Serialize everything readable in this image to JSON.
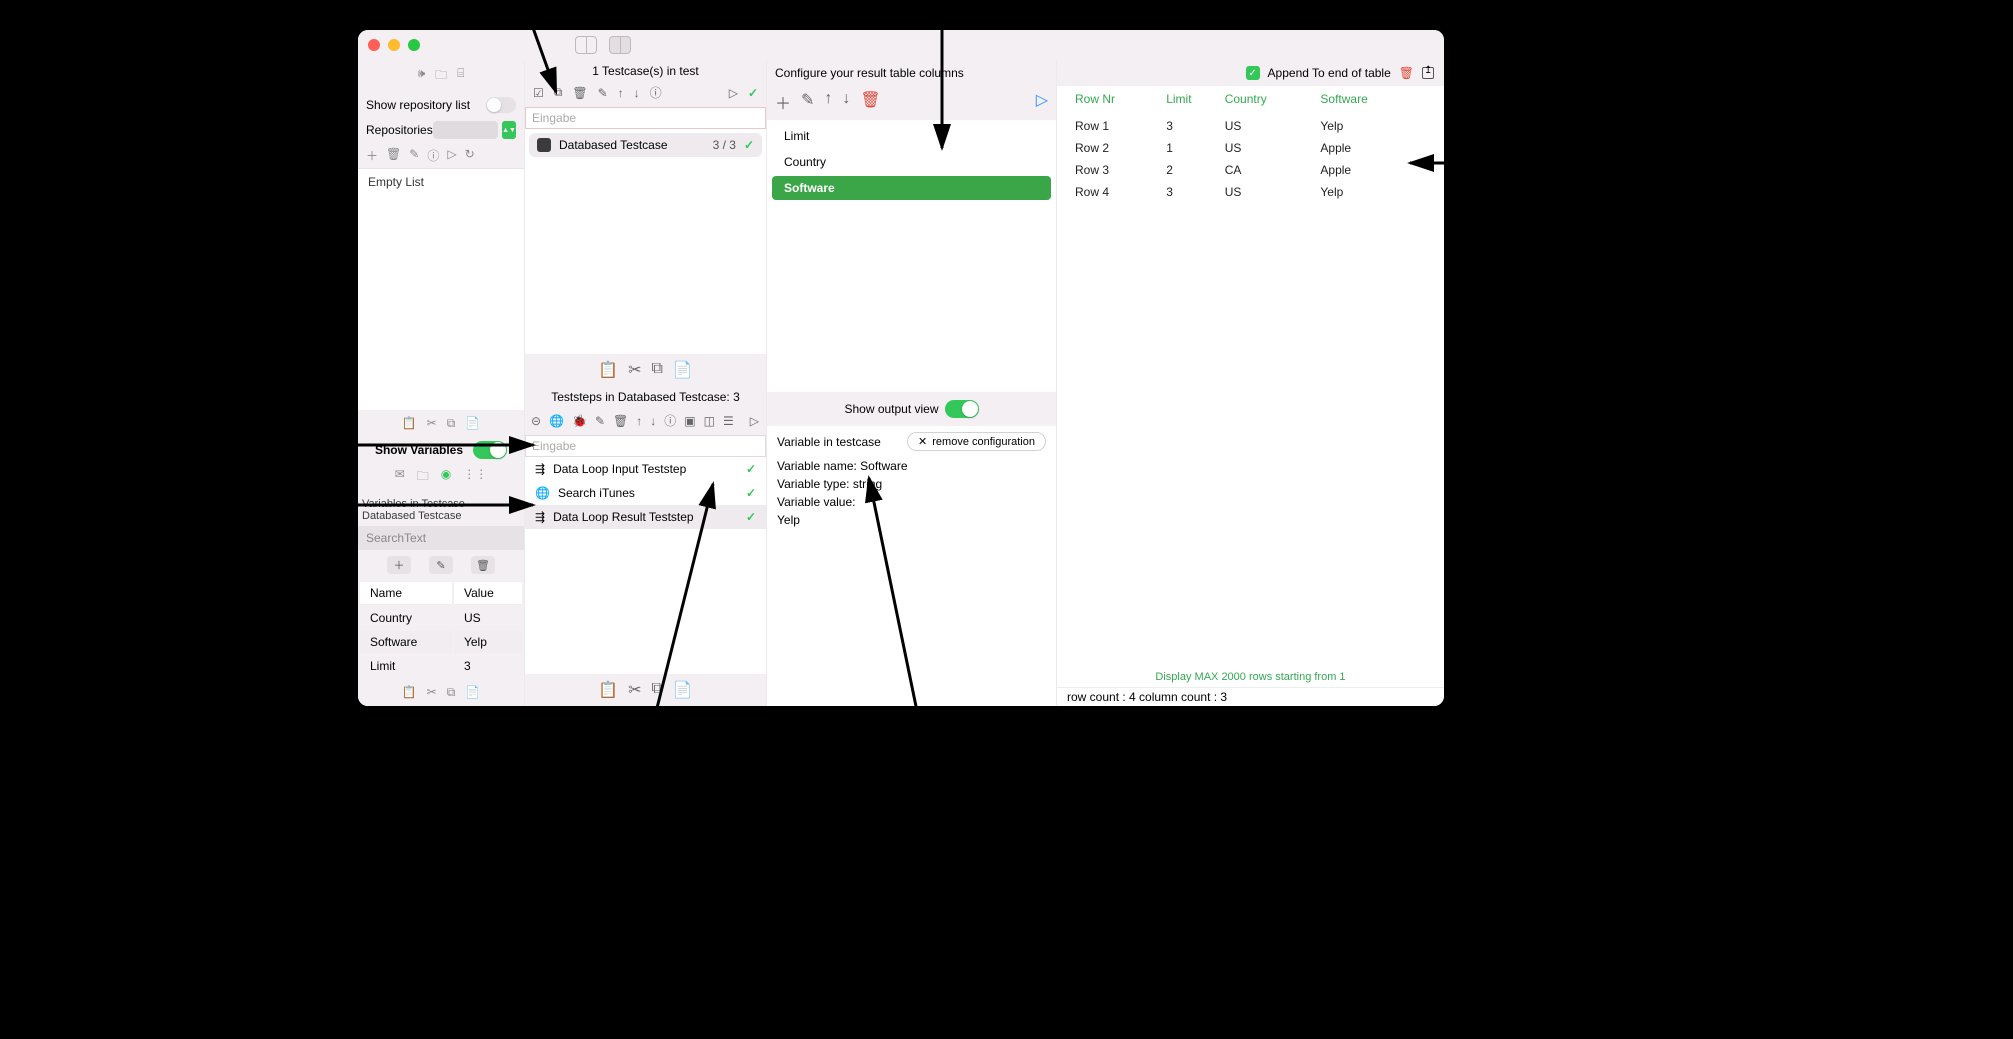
{
  "titlebar": {},
  "sidebar": {
    "show_repo_label": "Show repository list",
    "repositories_label": "Repositories",
    "list_items": [
      "Empty List"
    ],
    "show_vars_label": "Show Variables",
    "vars_header": "Variables in Testcase Databased Testcase",
    "search_placeholder": "SearchText",
    "var_columns": {
      "name": "Name",
      "value": "Value"
    },
    "variables": [
      {
        "name": "Country",
        "value": "US"
      },
      {
        "name": "Software",
        "value": "Yelp"
      },
      {
        "name": "Limit",
        "value": "3"
      }
    ]
  },
  "testcases": {
    "title": "1 Testcase(s) in test",
    "search_placeholder": "Eingabe",
    "rows": [
      {
        "name": "Databased Testcase",
        "stat": "3  /  3"
      }
    ],
    "teststeps_title": "Teststeps in Databased Testcase: 3",
    "teststep_search_placeholder": "Eingabe",
    "teststeps": [
      {
        "name": "Data Loop Input Teststep"
      },
      {
        "name": "Search iTunes"
      },
      {
        "name": "Data Loop Result Teststep"
      }
    ]
  },
  "config": {
    "title": "Configure your result table columns",
    "items": [
      "Limit",
      "Country",
      "Software"
    ],
    "active_index": 2,
    "output_label": "Show output view",
    "varpanel": {
      "scope": "Variable in  testcase",
      "remove_label": "remove configuration",
      "name_line": "Variable name: Software",
      "type_line": "Variable type: string",
      "value_line": "Variable value:",
      "value": "Yelp"
    }
  },
  "results": {
    "append_label": "Append To end of table",
    "columns": [
      "Row Nr",
      "Limit",
      "Country",
      "Software"
    ],
    "rows": [
      {
        "row": "Row 1",
        "limit": "3",
        "country": "US",
        "software": "Yelp"
      },
      {
        "row": "Row 2",
        "limit": "1",
        "country": "US",
        "software": "Apple"
      },
      {
        "row": "Row 3",
        "limit": "2",
        "country": "CA",
        "software": "Apple"
      },
      {
        "row": "Row 4",
        "limit": "3",
        "country": "US",
        "software": "Yelp"
      }
    ],
    "footer": "Display MAX 2000 rows starting from 1",
    "counts": "row count : 4  column count : 3"
  }
}
